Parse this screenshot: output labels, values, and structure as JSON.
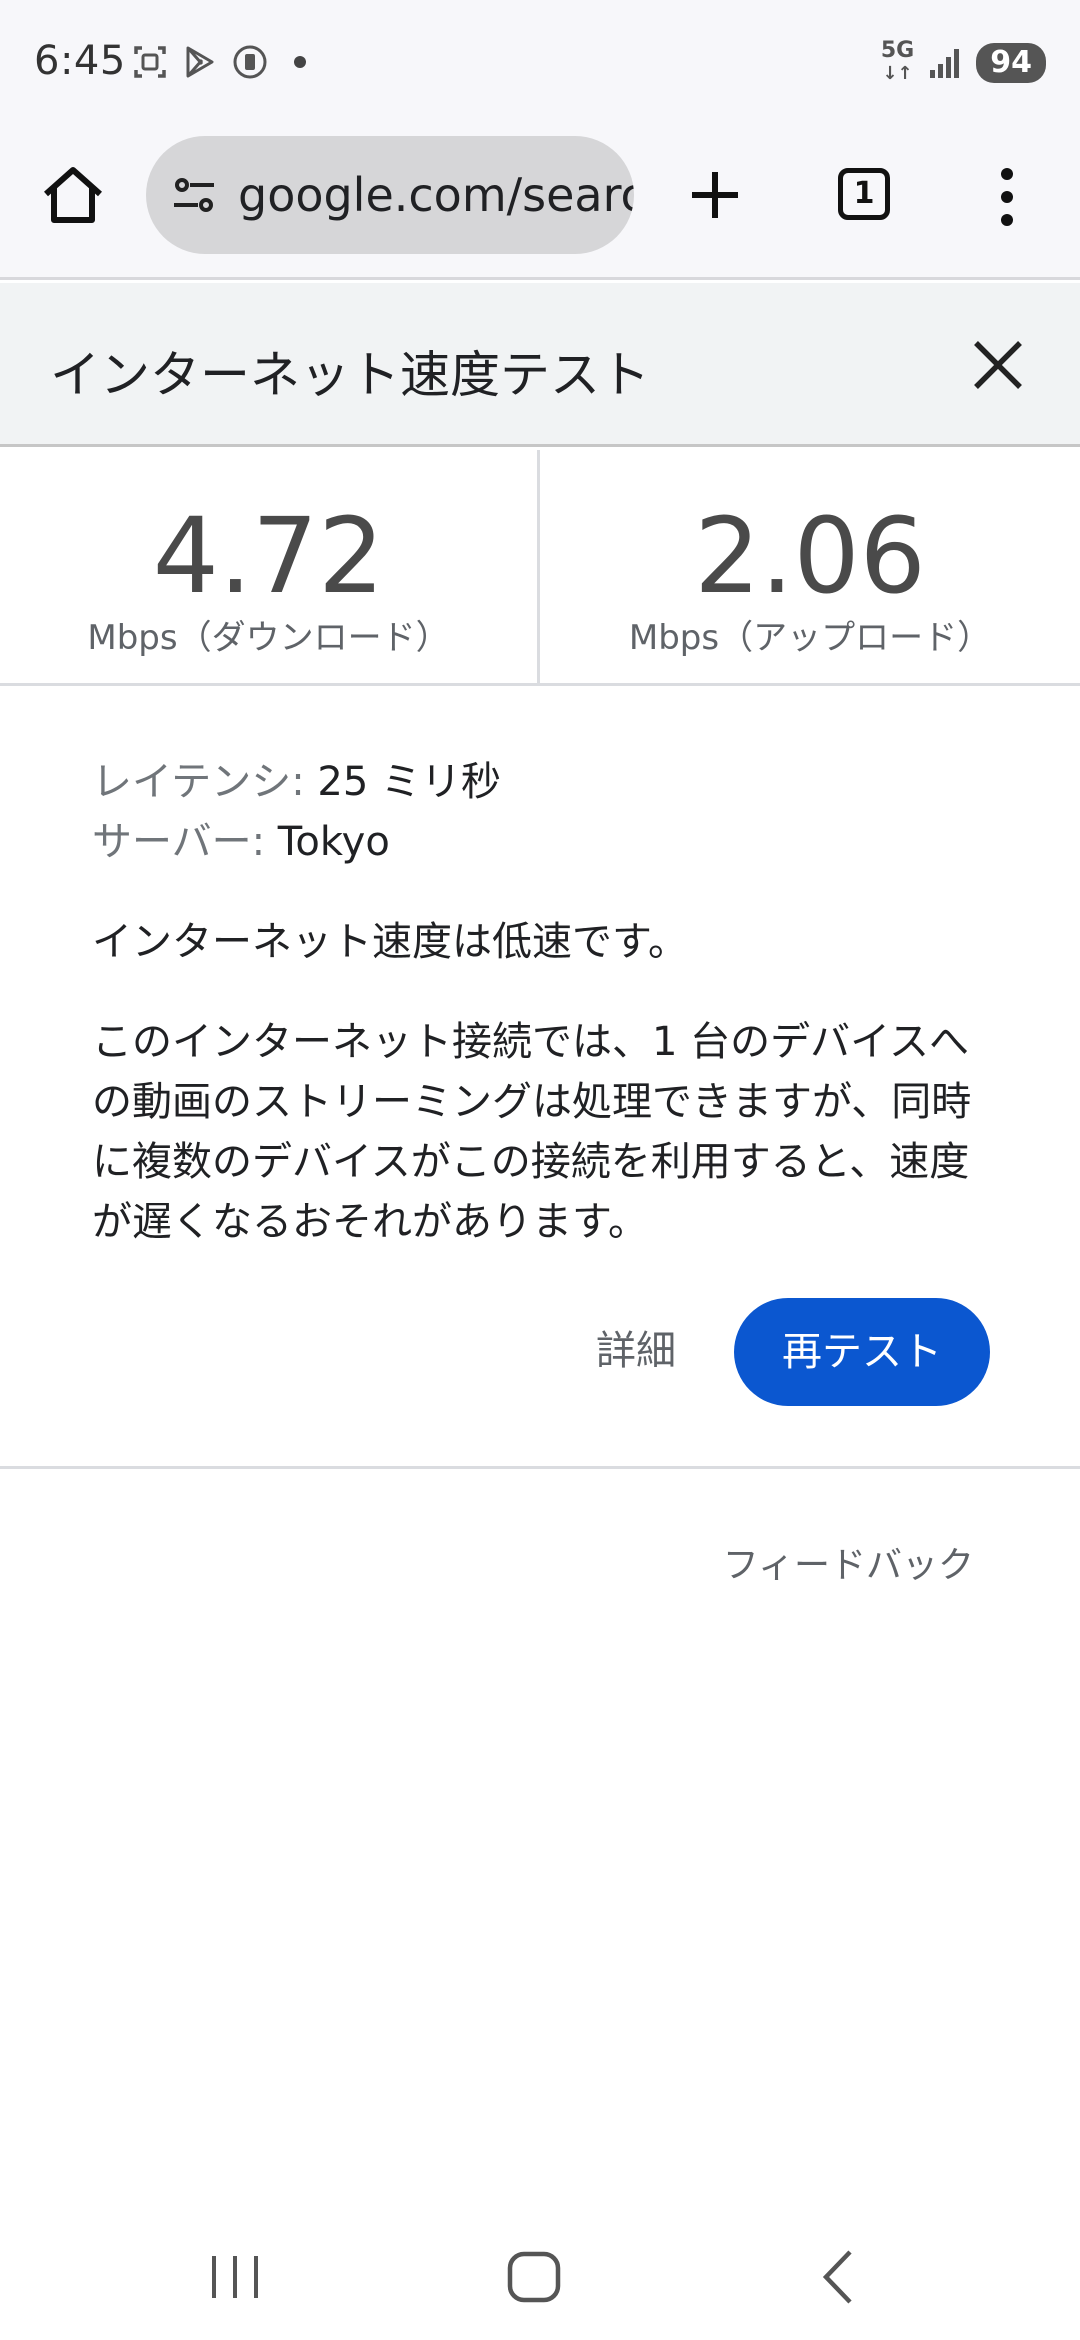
{
  "status_bar": {
    "time": "6:45",
    "network": "5G",
    "battery": "94",
    "icons": [
      "screenshot-icon",
      "play-store-icon",
      "sim-icon",
      "notification-dot",
      "signal-icon"
    ]
  },
  "browser": {
    "url": "google.com/search",
    "tab_count": "1",
    "icons": [
      "home-icon",
      "site-settings-icon",
      "new-tab-icon",
      "tab-switcher-icon",
      "more-menu-icon"
    ]
  },
  "panel": {
    "title": "インターネット速度テスト",
    "close_icon": "close-icon"
  },
  "speed": {
    "download_value": "4.72",
    "download_unit": "Mbps（ダウンロード）",
    "upload_value": "2.06",
    "upload_unit": "Mbps（アップロード）"
  },
  "details": {
    "latency_label": "レイテンシ:",
    "latency_value": " 25 ミリ秒",
    "server_label": "サーバー:",
    "server_value": " Tokyo",
    "summary": "インターネット速度は低速です。",
    "description": "このインターネット接続では、1 台のデバイスへの動画のストリーミングは処理できますが、同時に複数のデバイスがこの接続を利用すると、速度が遅くなるおそれがあります。"
  },
  "actions": {
    "details_label": "詳細",
    "retest_label": "再テスト",
    "feedback_label": "フィードバック"
  },
  "nav": {
    "icons": [
      "recent-apps-icon",
      "home-nav-icon",
      "back-icon"
    ]
  },
  "colors": {
    "accent": "#0b57d0",
    "header_bg": "#f1f3f4"
  }
}
